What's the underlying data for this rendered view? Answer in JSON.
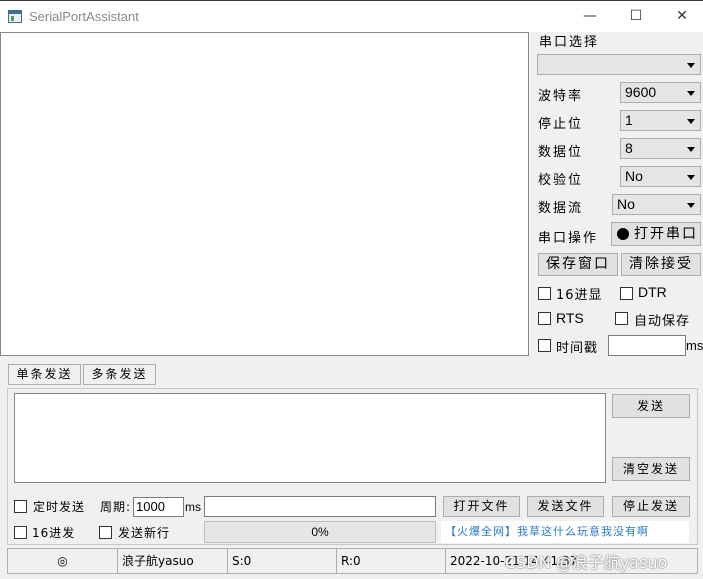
{
  "window": {
    "title": "SerialPortAssistant",
    "minimize_glyph": "—",
    "maximize_glyph": "☐",
    "close_glyph": "✕"
  },
  "settings": {
    "port_select_label": "串口选择",
    "port_value": "",
    "baud_label": "波特率",
    "baud_value": "9600",
    "stop_label": "停止位",
    "stop_value": "1",
    "data_label": "数据位",
    "data_value": "8",
    "parity_label": "校验位",
    "parity_value": "No",
    "flow_label": "数据流",
    "flow_value": "No",
    "port_op_label": "串口操作",
    "open_port_button": "打开串口",
    "save_window_button": "保存窗口",
    "clear_receive_button": "清除接受"
  },
  "options": {
    "hex_display": "16进显",
    "dtr": "DTR",
    "rts": "RTS",
    "auto_save": "自动保存",
    "timestamp": "时间戳",
    "timestamp_unit": "ms",
    "timestamp_value": ""
  },
  "tabs": {
    "single_send": "单条发送",
    "multi_send": "多条发送"
  },
  "send": {
    "send_button": "发送",
    "clear_send_button": "清空发送",
    "timed_send": "定时发送",
    "period_label": "周期:",
    "period_value": "1000",
    "period_unit": "ms",
    "file_path_value": "",
    "open_file_button": "打开文件",
    "send_file_button": "发送文件",
    "stop_send_button": "停止发送",
    "hex_send": "16进发",
    "send_newline": "发送新行",
    "progress_text": "0%",
    "progress_value": 0,
    "marquee_text": "【火爆全网】我草这什么玩意我没有啊"
  },
  "status": {
    "icon_glyph": "◎",
    "user": "浪子航yasuo",
    "sent": "S:0",
    "received": "R:0",
    "datetime": "2022-10-21 14:41:37"
  },
  "watermark": "CSDN @浪子航yasuo"
}
